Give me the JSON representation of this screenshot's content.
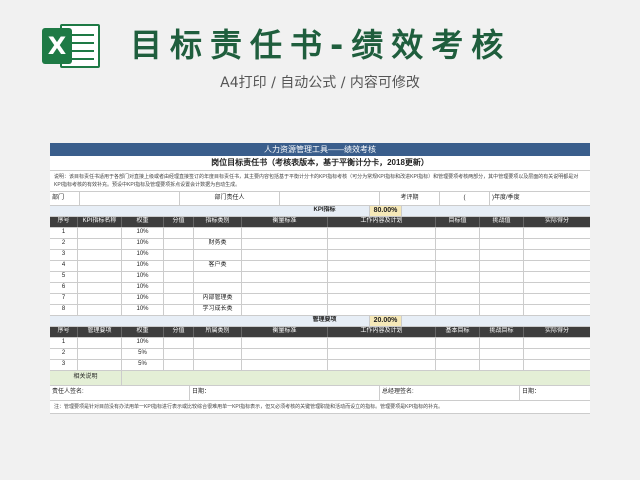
{
  "banner": {
    "logo_letter": "X",
    "title": "目标责任书-绩效考核",
    "subtitle": "A4打印 / 自动公式 / 内容可修改"
  },
  "sheet": {
    "bar_title": "人力资源管理工具——绩效考核",
    "doc_title": "岗位目标责任书（考核表版本，基于平衡计分卡，2018更新）",
    "intro": "说明：该目标责任书适用于各部门对直接上级或者由经理直接签订的年度目标责任书，其主要内容包括基于平衡计分卡的KPI指标考核（可分为常规KPI指标和改进KPI指标）和管理要项考核两部分，其中管理要项以及层面的有关说明都是对KPI指标考核的有效补充。预设中KPI指标及管理要项拆点设置会计数据为自动生成。",
    "info": {
      "dept_label": "部门",
      "owner_label": "部门责任人",
      "period_label": "考评期",
      "paren_open": "(",
      "year_label": ")年度/季度"
    },
    "kpi": {
      "label": "KPI指标",
      "pct": "80.00%",
      "headers": [
        "序号",
        "KPI指标名称",
        "权重",
        "分值",
        "指标类别",
        "衡量标准",
        "工作内容及计划",
        "目标值",
        "挑战值",
        "实际得分"
      ],
      "rows": [
        {
          "no": "1",
          "weight": "10%",
          "cat": ""
        },
        {
          "no": "2",
          "weight": "10%",
          "cat": "财务类"
        },
        {
          "no": "3",
          "weight": "10%",
          "cat": ""
        },
        {
          "no": "4",
          "weight": "10%",
          "cat": "客户类"
        },
        {
          "no": "5",
          "weight": "10%",
          "cat": ""
        },
        {
          "no": "6",
          "weight": "10%",
          "cat": ""
        },
        {
          "no": "7",
          "weight": "10%",
          "cat": "内部管理类"
        },
        {
          "no": "8",
          "weight": "10%",
          "cat": "学习成长类"
        }
      ]
    },
    "mgmt": {
      "label": "管理要项",
      "pct": "20.00%",
      "headers": [
        "序号",
        "管理要项",
        "权重",
        "分值",
        "所属类别",
        "衡量标准",
        "工作内容及计划",
        "基本目标",
        "挑战目标",
        "实际得分"
      ],
      "rows": [
        {
          "no": "1",
          "weight": "10%"
        },
        {
          "no": "2",
          "weight": "5%"
        },
        {
          "no": "3",
          "weight": "5%"
        }
      ],
      "remark_label": "相关说明"
    },
    "sign": {
      "owner": "责任人签名:",
      "date1": "日期：",
      "manager": "总经理签名:",
      "date2": "日期："
    },
    "footnote": "注：管理要项是针对目前没有办法用单一KPI指标进行表示或比较综合很难用单一KPI指标表示，但又必须考核的关键管理职能和活动而设立的指标。管理要项是KPI指标的补充。"
  }
}
